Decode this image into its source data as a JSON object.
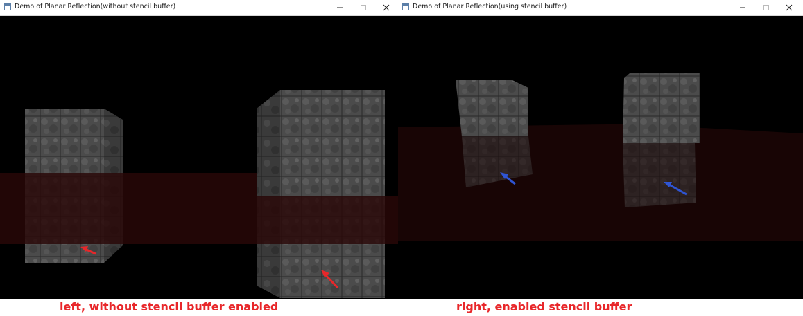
{
  "windows": {
    "left": {
      "title": "Demo of Planar Reflection(without stencil buffer)",
      "caption": "left, without stencil buffer enabled"
    },
    "right": {
      "title": "Demo of Planar Reflection(using stencil buffer)",
      "caption": "right, enabled stencil buffer"
    }
  },
  "window_controls": [
    "minimize-icon",
    "maximize-icon",
    "close-icon"
  ],
  "colors": {
    "caption_text": "#e8272a",
    "left_arrows": "#e8272a",
    "right_arrows": "#2f55d4",
    "mirror_plane": "#2a0707",
    "background": "#000000"
  }
}
